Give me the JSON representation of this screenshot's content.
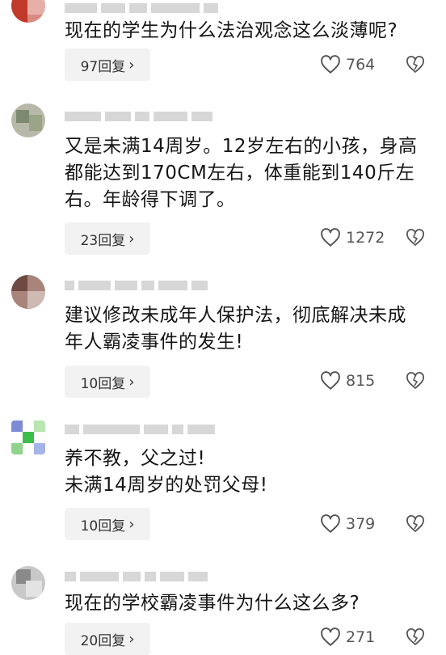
{
  "comments": [
    {
      "text_lines": [
        "现在的学生为什么法治观念这么淡薄呢?"
      ],
      "reply_label": "97回复",
      "likes": "764"
    },
    {
      "text_lines": [
        "又是未满14周岁。12岁左右的小孩，身高",
        "都能达到170CM左右，体重能到140斤左",
        "右。年龄得下调了。"
      ],
      "reply_label": "23回复",
      "likes": "1272"
    },
    {
      "text_lines": [
        "建议修改未成年人保护法，彻底解决未成",
        "年人霸凌事件的发生!"
      ],
      "reply_label": "10回复",
      "likes": "815"
    },
    {
      "text_lines": [
        "养不教，父之过!",
        "未满14周岁的处罚父母!"
      ],
      "reply_label": "10回复",
      "likes": "379"
    },
    {
      "text_lines": [
        "现在的学校霸凌事件为什么这么多?"
      ],
      "reply_label": "20回复",
      "likes": "271"
    }
  ],
  "icons": {
    "reply_chevron": "chevron-right-icon",
    "like": "heart-outline-icon",
    "dislike": "broken-heart-icon"
  },
  "colors": {
    "text": "#161616",
    "reply_bg": "#f2f2f2",
    "icon": "#555555"
  }
}
